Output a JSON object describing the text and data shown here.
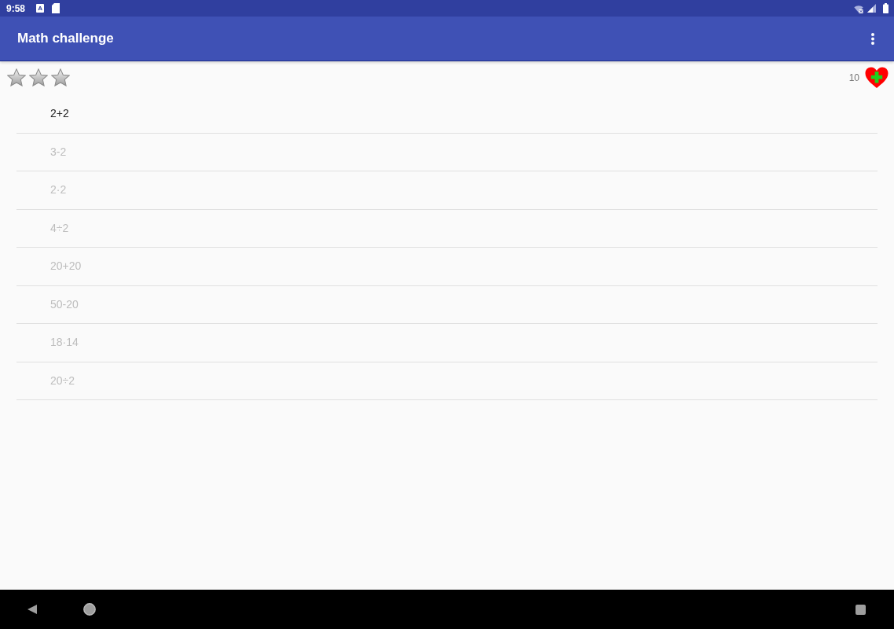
{
  "status_bar": {
    "time": "9:58",
    "notification_glyph": "A"
  },
  "app_bar": {
    "title": "Math challenge"
  },
  "progress": {
    "stars": 0,
    "lives": "10"
  },
  "problems": [
    {
      "label": "2+2",
      "disabled": false
    },
    {
      "label": "3-2",
      "disabled": true
    },
    {
      "label": "2·2",
      "disabled": true
    },
    {
      "label": "4÷2",
      "disabled": true
    },
    {
      "label": "20+20",
      "disabled": true
    },
    {
      "label": "50-20",
      "disabled": true
    },
    {
      "label": "18·14",
      "disabled": true
    },
    {
      "label": "20÷2",
      "disabled": true
    }
  ]
}
